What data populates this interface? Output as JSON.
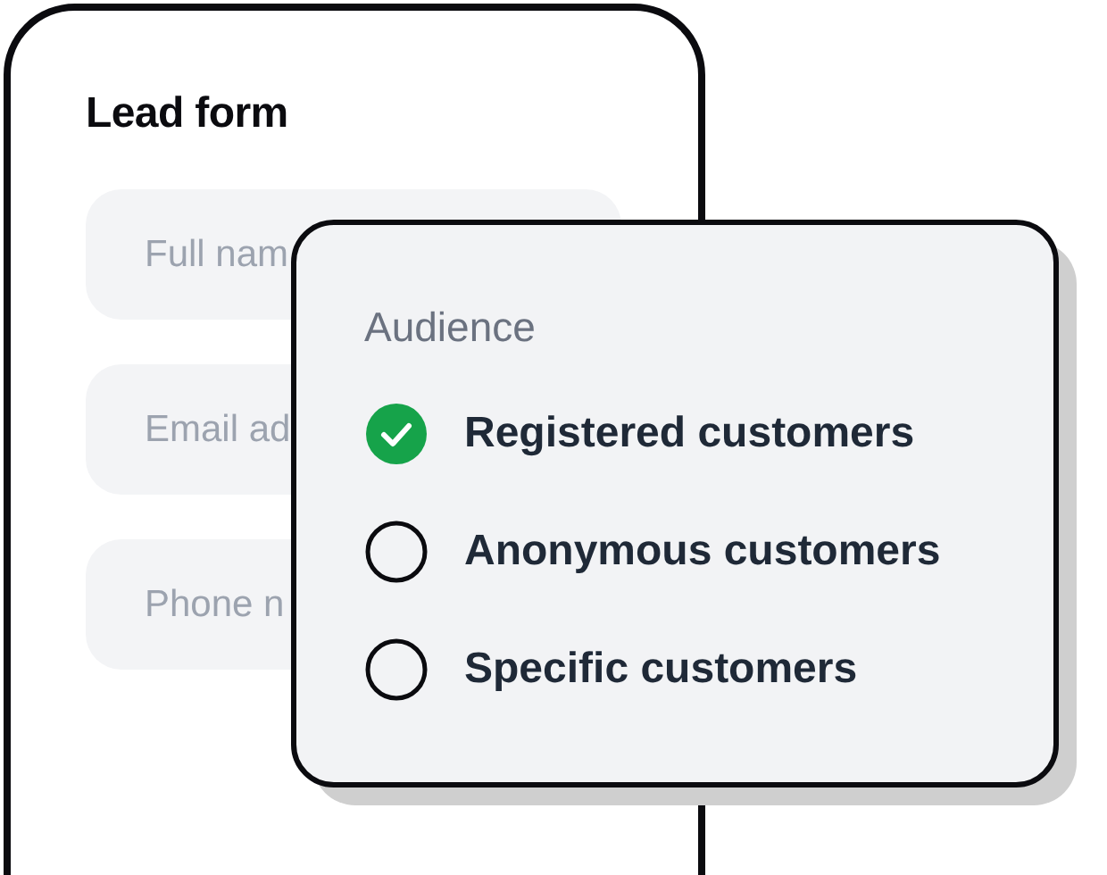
{
  "form": {
    "title": "Lead form",
    "fields": [
      {
        "placeholder": "Full nam"
      },
      {
        "placeholder": "Email ad"
      },
      {
        "placeholder": "Phone n"
      }
    ]
  },
  "audience": {
    "title": "Audience",
    "options": [
      {
        "label": "Registered customers",
        "selected": true
      },
      {
        "label": "Anonymous customers",
        "selected": false
      },
      {
        "label": "Specific customers",
        "selected": false
      }
    ]
  }
}
